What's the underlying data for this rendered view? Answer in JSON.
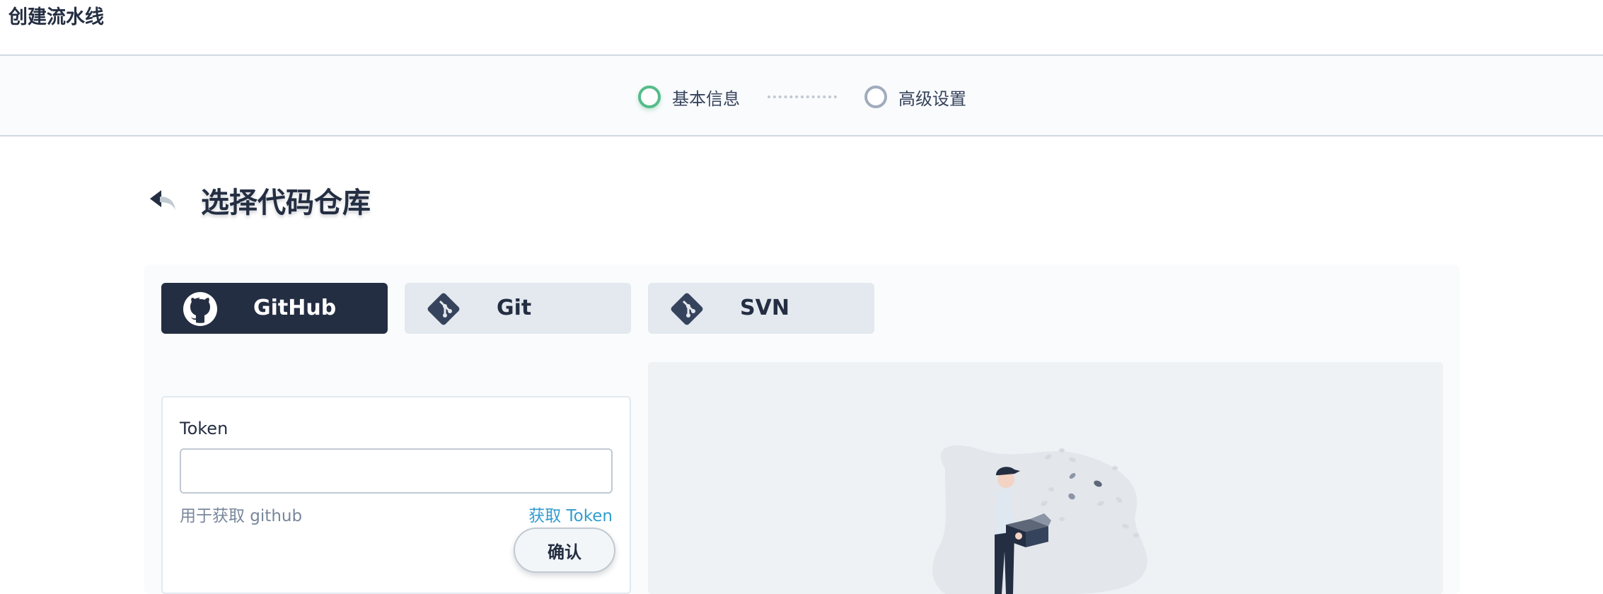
{
  "page": {
    "title": "创建流水线"
  },
  "steps": [
    {
      "label": "基本信息",
      "state": "active"
    },
    {
      "label": "高级设置",
      "state": "pending"
    }
  ],
  "section": {
    "title": "选择代码仓库"
  },
  "repo_tabs": [
    {
      "label": "GitHub",
      "icon": "github-icon",
      "active": true
    },
    {
      "label": "Git",
      "icon": "git-icon",
      "active": false
    },
    {
      "label": "SVN",
      "icon": "git-icon",
      "active": false
    }
  ],
  "token_form": {
    "label": "Token",
    "value": "",
    "placeholder": "",
    "hint": "用于获取 github",
    "link_label": "获取 Token",
    "confirm_label": "确认"
  },
  "illustration": {
    "icon": "empty-box-illustration"
  },
  "colors": {
    "accent_green": "#55bc8a",
    "dark": "#242e42",
    "link_blue": "#329dce",
    "muted": "#79879c"
  }
}
